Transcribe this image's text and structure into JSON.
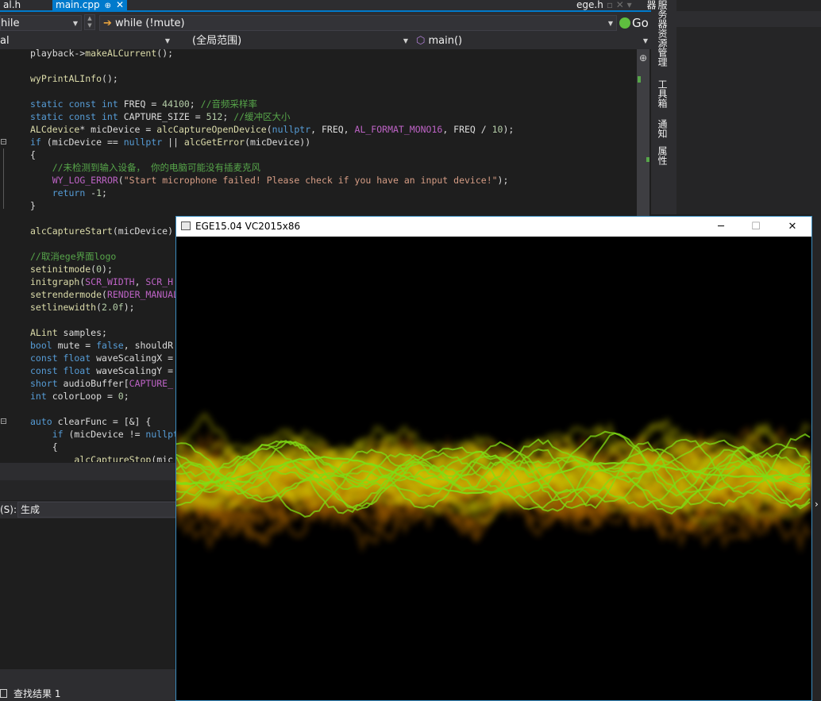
{
  "tabs": {
    "left_tab": "al.h",
    "active_tab": "main.cpp",
    "active_pin": "⊕",
    "active_close": "✕",
    "right_tab": "ege.h",
    "right_tab_controls": "▫ ✕ ▾"
  },
  "nav": {
    "scope_combo": "hile",
    "member_combo": "while (!mute)",
    "go_label": "Go",
    "project_combo": "al",
    "range_combo": "(全局范围)",
    "function_combo": "main()"
  },
  "code_lines": [
    {
      "p": [
        {
          "t": "playback->",
          "c": ""
        },
        {
          "t": "makeALCurrent",
          "c": "fn"
        },
        {
          "t": "();",
          "c": ""
        }
      ]
    },
    {
      "p": []
    },
    {
      "p": [
        {
          "t": "wyPrintALInfo",
          "c": "fn"
        },
        {
          "t": "();",
          "c": ""
        }
      ]
    },
    {
      "p": []
    },
    {
      "p": [
        {
          "t": "static const int ",
          "c": "kw"
        },
        {
          "t": "FREQ = ",
          "c": ""
        },
        {
          "t": "44100",
          "c": "num"
        },
        {
          "t": "; ",
          "c": ""
        },
        {
          "t": "//音频采样率",
          "c": "cm"
        }
      ]
    },
    {
      "p": [
        {
          "t": "static const int ",
          "c": "kw"
        },
        {
          "t": "CAPTURE_SIZE = ",
          "c": ""
        },
        {
          "t": "512",
          "c": "num"
        },
        {
          "t": "; ",
          "c": ""
        },
        {
          "t": "//缓冲区大小",
          "c": "cm"
        }
      ]
    },
    {
      "p": [
        {
          "t": "ALCdevice",
          "c": "fn"
        },
        {
          "t": "* micDevice = ",
          "c": ""
        },
        {
          "t": "alcCaptureOpenDevice",
          "c": "fn"
        },
        {
          "t": "(",
          "c": ""
        },
        {
          "t": "nullptr",
          "c": "kw"
        },
        {
          "t": ", FREQ, ",
          "c": ""
        },
        {
          "t": "AL_FORMAT_MONO16",
          "c": "mac"
        },
        {
          "t": ", FREQ / ",
          "c": ""
        },
        {
          "t": "10",
          "c": "num"
        },
        {
          "t": ");",
          "c": ""
        }
      ]
    },
    {
      "p": [
        {
          "t": "if ",
          "c": "kw"
        },
        {
          "t": "(micDevice == ",
          "c": ""
        },
        {
          "t": "nullptr",
          "c": "kw"
        },
        {
          "t": " || ",
          "c": ""
        },
        {
          "t": "alcGetError",
          "c": "fn"
        },
        {
          "t": "(micDevice))",
          "c": ""
        }
      ]
    },
    {
      "p": [
        {
          "t": "{",
          "c": ""
        }
      ]
    },
    {
      "p": [
        {
          "t": "    //未检测到输入设备， 你的电脑可能没有插麦克风",
          "c": "cm"
        }
      ]
    },
    {
      "p": [
        {
          "t": "    ",
          "c": ""
        },
        {
          "t": "WY_LOG_ERROR",
          "c": "mac"
        },
        {
          "t": "(",
          "c": ""
        },
        {
          "t": "\"Start microphone failed! Please check if you have an input device!\"",
          "c": "str"
        },
        {
          "t": ");",
          "c": ""
        }
      ]
    },
    {
      "p": [
        {
          "t": "    ",
          "c": ""
        },
        {
          "t": "return ",
          "c": "kw"
        },
        {
          "t": "-",
          "c": ""
        },
        {
          "t": "1",
          "c": "num"
        },
        {
          "t": ";",
          "c": ""
        }
      ]
    },
    {
      "p": [
        {
          "t": "}",
          "c": ""
        }
      ]
    },
    {
      "p": []
    },
    {
      "p": [
        {
          "t": "alcCaptureStart",
          "c": "fn"
        },
        {
          "t": "(micDevice)",
          "c": ""
        }
      ]
    },
    {
      "p": []
    },
    {
      "p": [
        {
          "t": "//取消ege界面logo",
          "c": "cm"
        }
      ]
    },
    {
      "p": [
        {
          "t": "setinitmode",
          "c": "fn"
        },
        {
          "t": "(",
          "c": ""
        },
        {
          "t": "0",
          "c": "num"
        },
        {
          "t": ");",
          "c": ""
        }
      ]
    },
    {
      "p": [
        {
          "t": "initgraph",
          "c": "fn"
        },
        {
          "t": "(",
          "c": ""
        },
        {
          "t": "SCR_WIDTH",
          "c": "mac"
        },
        {
          "t": ", ",
          "c": ""
        },
        {
          "t": "SCR_H",
          "c": "mac"
        }
      ]
    },
    {
      "p": [
        {
          "t": "setrendermode",
          "c": "fn"
        },
        {
          "t": "(",
          "c": ""
        },
        {
          "t": "RENDER_MANUAL",
          "c": "mac"
        }
      ]
    },
    {
      "p": [
        {
          "t": "setlinewidth",
          "c": "fn"
        },
        {
          "t": "(",
          "c": ""
        },
        {
          "t": "2.0f",
          "c": "num"
        },
        {
          "t": ");",
          "c": ""
        }
      ]
    },
    {
      "p": []
    },
    {
      "p": [
        {
          "t": "ALint",
          "c": "fn"
        },
        {
          "t": " samples;",
          "c": ""
        }
      ]
    },
    {
      "p": [
        {
          "t": "bool ",
          "c": "kw"
        },
        {
          "t": "mute = ",
          "c": ""
        },
        {
          "t": "false",
          "c": "kw"
        },
        {
          "t": ", shouldR",
          "c": ""
        }
      ]
    },
    {
      "p": [
        {
          "t": "const float ",
          "c": "kw"
        },
        {
          "t": "waveScalingX =",
          "c": ""
        }
      ]
    },
    {
      "p": [
        {
          "t": "const float ",
          "c": "kw"
        },
        {
          "t": "waveScalingY =",
          "c": ""
        }
      ]
    },
    {
      "p": [
        {
          "t": "short ",
          "c": "kw"
        },
        {
          "t": "audioBuffer[",
          "c": ""
        },
        {
          "t": "CAPTURE_",
          "c": "mac"
        }
      ]
    },
    {
      "p": [
        {
          "t": "int ",
          "c": "kw"
        },
        {
          "t": "colorLoop = ",
          "c": ""
        },
        {
          "t": "0",
          "c": "num"
        },
        {
          "t": ";",
          "c": ""
        }
      ]
    },
    {
      "p": []
    },
    {
      "p": [
        {
          "t": "auto ",
          "c": "kw"
        },
        {
          "t": "clearFunc = [&] {",
          "c": ""
        }
      ]
    },
    {
      "p": [
        {
          "t": "    ",
          "c": ""
        },
        {
          "t": "if ",
          "c": "kw"
        },
        {
          "t": "(micDevice != ",
          "c": ""
        },
        {
          "t": "nullpt",
          "c": "kw"
        }
      ]
    },
    {
      "p": [
        {
          "t": "    {",
          "c": ""
        }
      ]
    },
    {
      "p": [
        {
          "t": "        ",
          "c": ""
        },
        {
          "t": "alcCaptureStop",
          "c": "fn"
        },
        {
          "t": "(mic",
          "c": ""
        }
      ]
    }
  ],
  "side_tabs": [
    "服务器资源管理器",
    "工具箱",
    "通知",
    "属性"
  ],
  "output": {
    "label": "(S):",
    "combo_value": "生成"
  },
  "find_tab": "查找结果 1",
  "right_arrow": "›",
  "ege_window": {
    "title": "EGE15.04 VC2015x86",
    "minimize": "─",
    "maximize": "☐",
    "close": "✕"
  },
  "colors": {
    "vs_bg": "#1e1e1e",
    "vs_accent": "#007acc",
    "wave_green": "#7fdc14",
    "wave_yellow": "#d8d000",
    "wave_orange": "#b86a00"
  }
}
